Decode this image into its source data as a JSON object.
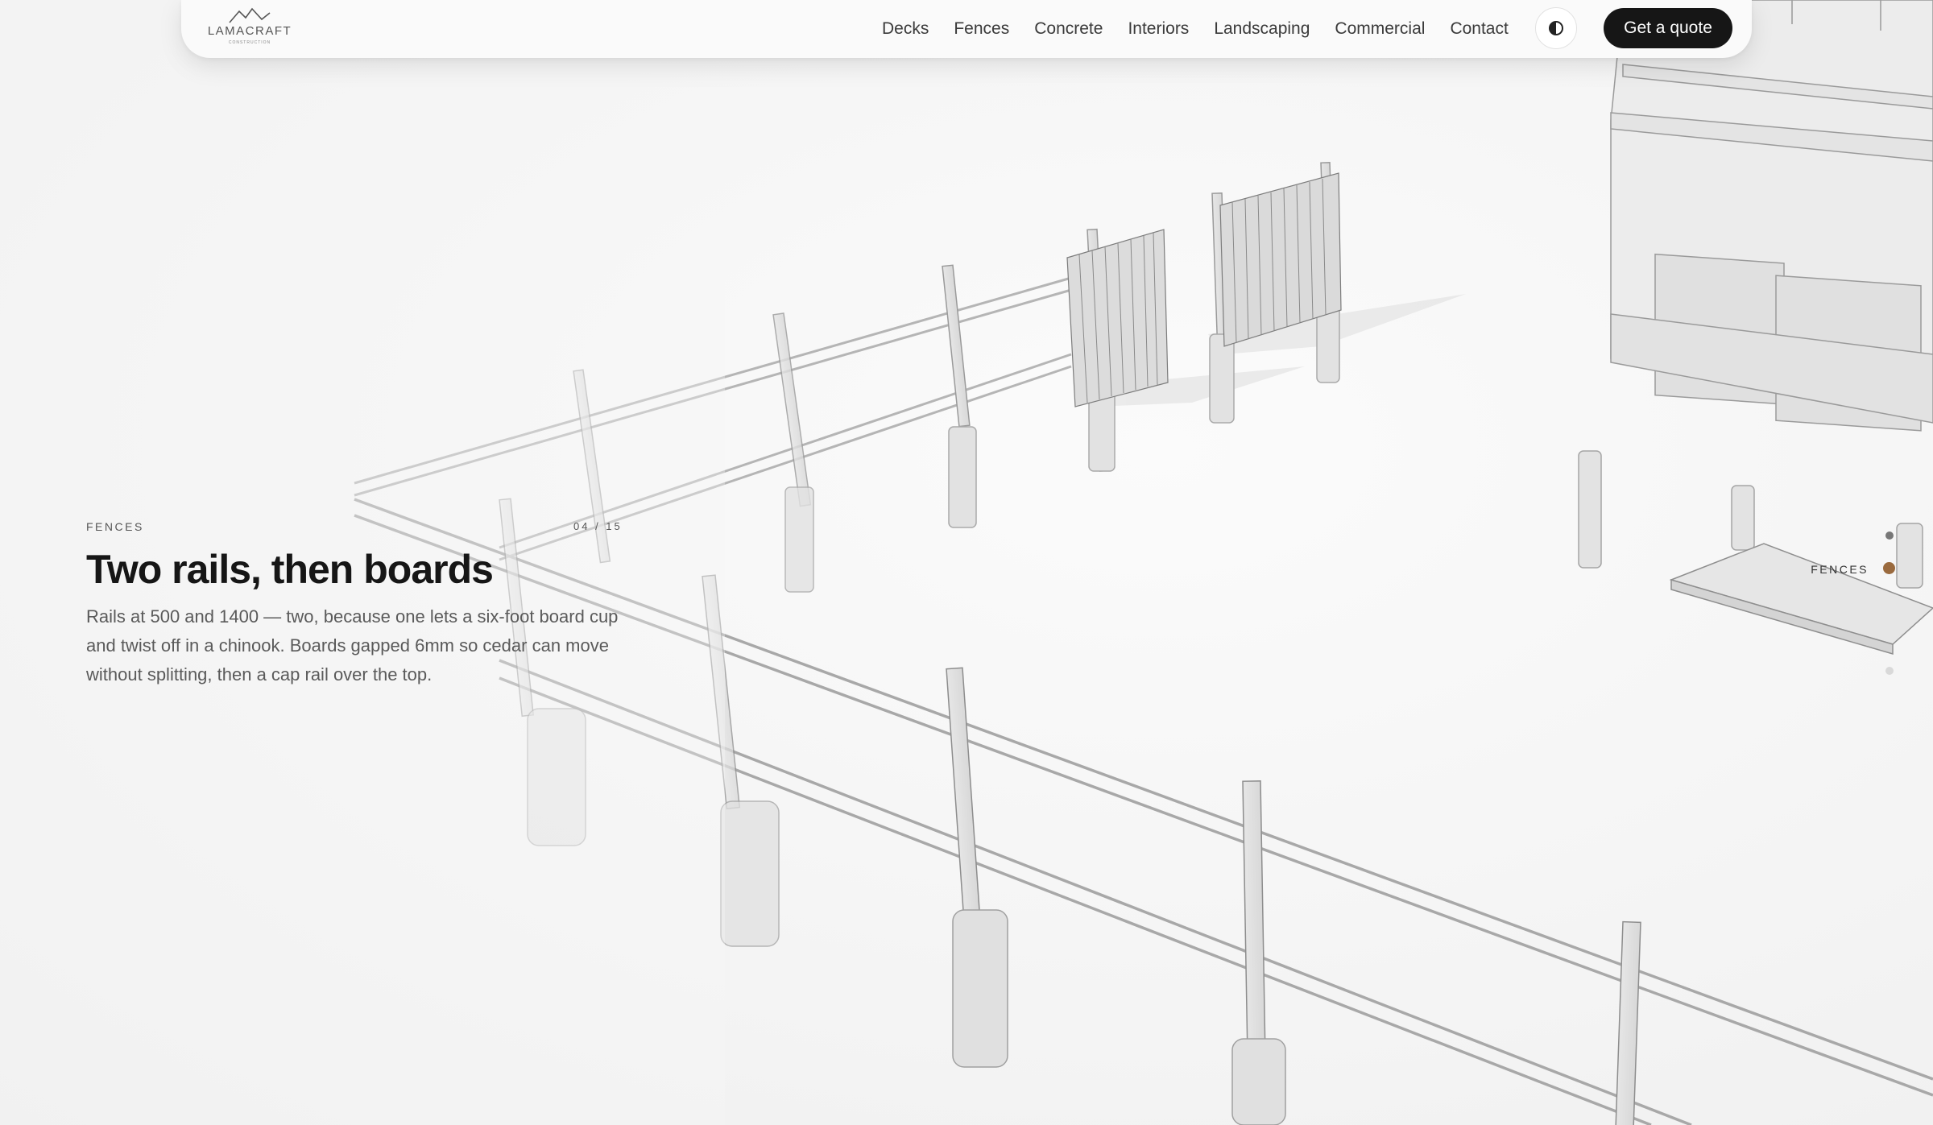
{
  "brand": {
    "name": "LAMACRAFT",
    "tagline": "CONSTRUCTION"
  },
  "nav": {
    "links": [
      "Decks",
      "Fences",
      "Concrete",
      "Interiors",
      "Landscaping",
      "Commercial",
      "Contact"
    ],
    "theme_toggle_icon": "contrast-icon",
    "cta_label": "Get a quote"
  },
  "slide": {
    "category": "FENCES",
    "counter": "04 / 15",
    "title": "Two rails, then boards",
    "body": "Rails at 500 and 1400 — two, because one lets a six-foot board cup and twist off in a chinook. Boards gapped 6mm so cedar can move without splitting, then a cap rail over the top."
  },
  "pager": {
    "active_label": "FENCES"
  },
  "colors": {
    "accent": "#9a6a3e",
    "cta_bg": "#161616",
    "background": "#f5f5f5"
  }
}
